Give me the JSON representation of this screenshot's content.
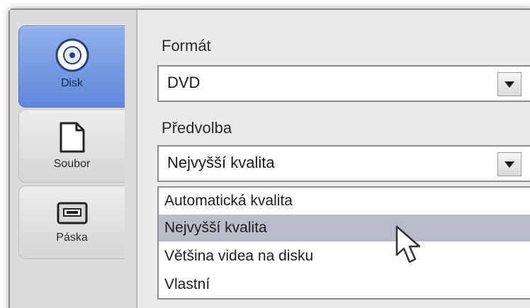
{
  "tabs": [
    {
      "label": "Disk",
      "icon": "disc-icon",
      "active": true
    },
    {
      "label": "Soubor",
      "icon": "file-icon",
      "active": false
    },
    {
      "label": "Páska",
      "icon": "tape-icon",
      "active": false
    }
  ],
  "format": {
    "label": "Formát",
    "value": "DVD"
  },
  "preset": {
    "label": "Předvolba",
    "value": "Nejvyšší kvalita",
    "options": [
      "Automatická kvalita",
      "Nejvyšší kvalita",
      "Většina videa na disku",
      "Vlastní"
    ],
    "hovered_option": "Nejvyšší kvalita"
  },
  "colors": {
    "active_tab": "#6f96e0",
    "hover_row": "#b8bccb"
  }
}
